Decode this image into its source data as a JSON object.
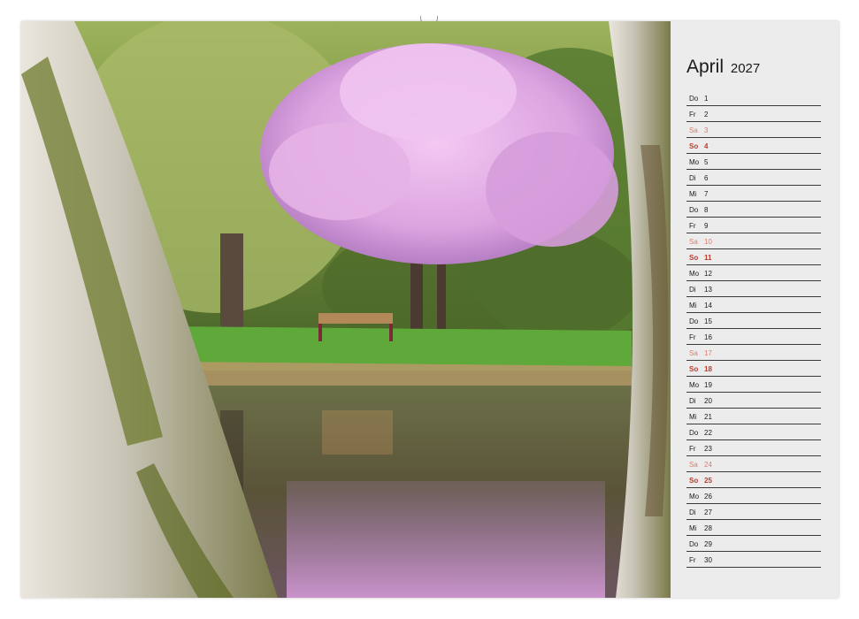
{
  "calendar": {
    "month": "April",
    "year": "2027",
    "days": [
      {
        "wd": "Do",
        "d": "1",
        "type": "weekday"
      },
      {
        "wd": "Fr",
        "d": "2",
        "type": "weekday"
      },
      {
        "wd": "Sa",
        "d": "3",
        "type": "sat"
      },
      {
        "wd": "So",
        "d": "4",
        "type": "sun"
      },
      {
        "wd": "Mo",
        "d": "5",
        "type": "weekday"
      },
      {
        "wd": "Di",
        "d": "6",
        "type": "weekday"
      },
      {
        "wd": "Mi",
        "d": "7",
        "type": "weekday"
      },
      {
        "wd": "Do",
        "d": "8",
        "type": "weekday"
      },
      {
        "wd": "Fr",
        "d": "9",
        "type": "weekday"
      },
      {
        "wd": "Sa",
        "d": "10",
        "type": "sat"
      },
      {
        "wd": "So",
        "d": "11",
        "type": "sun"
      },
      {
        "wd": "Mo",
        "d": "12",
        "type": "weekday"
      },
      {
        "wd": "Di",
        "d": "13",
        "type": "weekday"
      },
      {
        "wd": "Mi",
        "d": "14",
        "type": "weekday"
      },
      {
        "wd": "Do",
        "d": "15",
        "type": "weekday"
      },
      {
        "wd": "Fr",
        "d": "16",
        "type": "weekday"
      },
      {
        "wd": "Sa",
        "d": "17",
        "type": "sat"
      },
      {
        "wd": "So",
        "d": "18",
        "type": "sun"
      },
      {
        "wd": "Mo",
        "d": "19",
        "type": "weekday"
      },
      {
        "wd": "Di",
        "d": "20",
        "type": "weekday"
      },
      {
        "wd": "Mi",
        "d": "21",
        "type": "weekday"
      },
      {
        "wd": "Do",
        "d": "22",
        "type": "weekday"
      },
      {
        "wd": "Fr",
        "d": "23",
        "type": "weekday"
      },
      {
        "wd": "Sa",
        "d": "24",
        "type": "sat"
      },
      {
        "wd": "So",
        "d": "25",
        "type": "sun"
      },
      {
        "wd": "Mo",
        "d": "26",
        "type": "weekday"
      },
      {
        "wd": "Di",
        "d": "27",
        "type": "weekday"
      },
      {
        "wd": "Mi",
        "d": "28",
        "type": "weekday"
      },
      {
        "wd": "Do",
        "d": "29",
        "type": "weekday"
      },
      {
        "wd": "Fr",
        "d": "30",
        "type": "weekday"
      }
    ]
  },
  "colors": {
    "saturday": "#e07a6a",
    "sunday": "#c0392b",
    "panel_background": "#ececec",
    "blossom": "#d9a6e0",
    "grass": "#5fa83a",
    "water": "#5c5a3e"
  }
}
